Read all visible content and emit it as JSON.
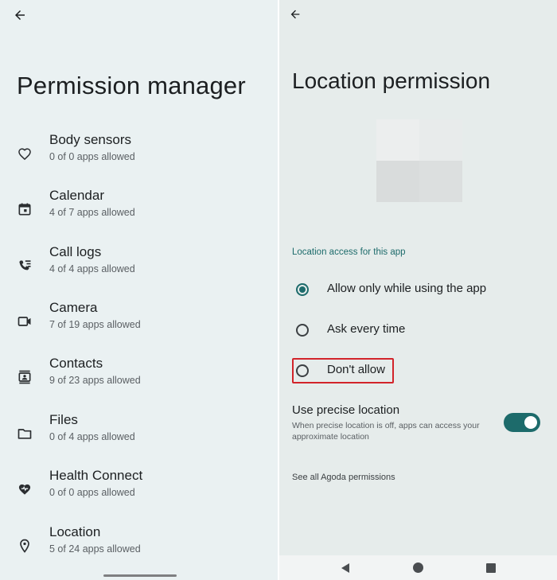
{
  "left": {
    "title": "Permission manager",
    "items": [
      {
        "label": "Body sensors",
        "sub": "0 of 0 apps allowed",
        "icon": "heart-icon"
      },
      {
        "label": "Calendar",
        "sub": "4 of 7 apps allowed",
        "icon": "calendar-icon"
      },
      {
        "label": "Call logs",
        "sub": "4 of 4 apps allowed",
        "icon": "call-log-icon"
      },
      {
        "label": "Camera",
        "sub": "7 of 19 apps allowed",
        "icon": "camera-icon"
      },
      {
        "label": "Contacts",
        "sub": "9 of 23 apps allowed",
        "icon": "contacts-icon"
      },
      {
        "label": "Files",
        "sub": "0 of 4 apps allowed",
        "icon": "folder-icon"
      },
      {
        "label": "Health Connect",
        "sub": "0 of 0 apps allowed",
        "icon": "health-connect-icon"
      },
      {
        "label": "Location",
        "sub": "5 of 24 apps allowed",
        "icon": "location-pin-icon"
      }
    ]
  },
  "right": {
    "title": "Location permission",
    "section_header": "Location access for this app",
    "options": [
      {
        "label": "Allow only while using the app",
        "selected": true
      },
      {
        "label": "Ask every time",
        "selected": false
      },
      {
        "label": "Don't allow",
        "selected": false
      }
    ],
    "precise": {
      "title": "Use precise location",
      "description": "When precise location is off, apps can access your approximate location",
      "enabled": true
    },
    "see_all": "See all Agoda permissions"
  },
  "colors": {
    "accent": "#1d6b6b",
    "highlight": "#d2242a",
    "left_bg": "#eaf1f2",
    "right_bg": "#e6eceb"
  }
}
